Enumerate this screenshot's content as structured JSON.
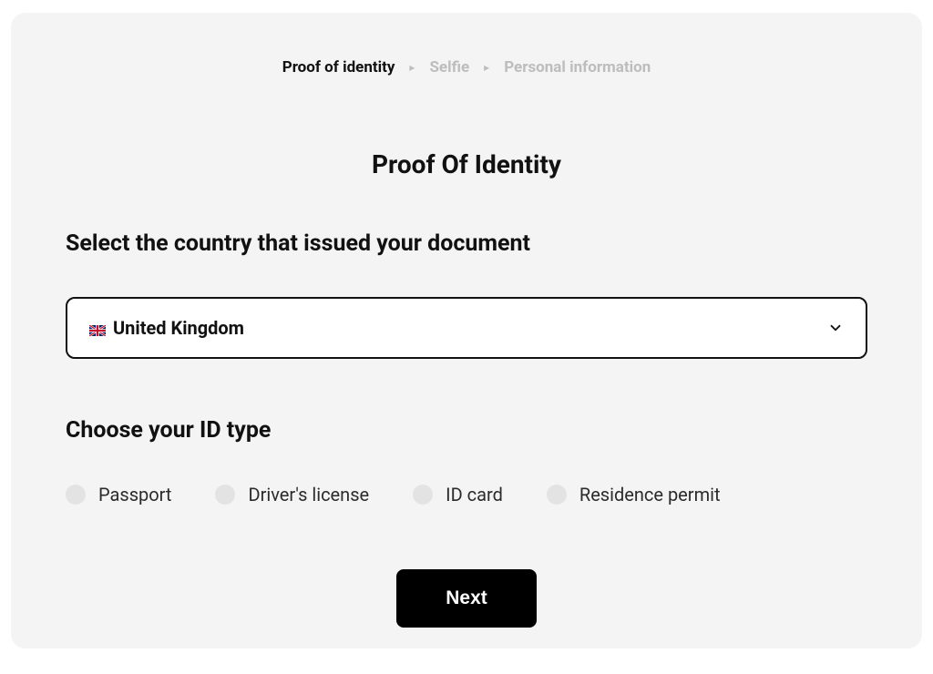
{
  "breadcrumb": {
    "items": [
      {
        "label": "Proof of identity",
        "active": true
      },
      {
        "label": "Selfie",
        "active": false
      },
      {
        "label": "Personal information",
        "active": false
      }
    ]
  },
  "header": {
    "title": "Proof Of Identity"
  },
  "country": {
    "label": "Select the country that issued your document",
    "selected": "United Kingdom",
    "flag": "uk"
  },
  "idType": {
    "label": "Choose your ID type",
    "options": [
      {
        "label": "Passport"
      },
      {
        "label": "Driver's license"
      },
      {
        "label": "ID card"
      },
      {
        "label": "Residence permit"
      }
    ]
  },
  "actions": {
    "next": "Next"
  }
}
